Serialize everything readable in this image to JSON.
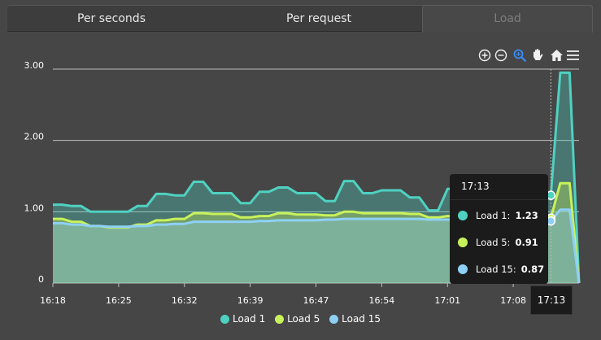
{
  "tabs": [
    {
      "label": "Per seconds",
      "active": false
    },
    {
      "label": "Per request",
      "active": false
    },
    {
      "label": "Load",
      "active": true
    }
  ],
  "toolbar": {
    "icons": [
      "zoom-in-icon",
      "zoom-out-icon",
      "selection-zoom-icon",
      "pan-hand-icon",
      "home-reset-icon",
      "menu-icon"
    ]
  },
  "colors": {
    "load1": "#4fd1c1",
    "load5": "#c8f25a",
    "load15": "#8ed0f5",
    "background": "#464646",
    "tooltip": "#1b1b1b"
  },
  "chart_data": {
    "type": "area",
    "ylim": [
      0,
      3
    ],
    "yticks": [
      "0",
      "1.00",
      "2.00",
      "3.00"
    ],
    "xticks": [
      "16:18",
      "16:25",
      "16:32",
      "16:39",
      "16:47",
      "16:54",
      "17:01",
      "17:08",
      "17:13"
    ],
    "legend_position": "bottom",
    "grid": true,
    "series": [
      {
        "name": "Load 1",
        "color": "#4fd1c1",
        "values": [
          1.1,
          1.1,
          1.08,
          1.08,
          1.0,
          1.0,
          1.0,
          1.0,
          1.0,
          1.08,
          1.08,
          1.25,
          1.25,
          1.23,
          1.23,
          1.42,
          1.42,
          1.26,
          1.26,
          1.26,
          1.12,
          1.12,
          1.28,
          1.28,
          1.34,
          1.34,
          1.26,
          1.26,
          1.26,
          1.15,
          1.15,
          1.43,
          1.43,
          1.26,
          1.26,
          1.3,
          1.3,
          1.3,
          1.2,
          1.2,
          1.02,
          1.02,
          1.32,
          1.32,
          1.38,
          1.38,
          1.25,
          1.25,
          1.2,
          1.2,
          1.4,
          1.4,
          1.22,
          1.23,
          2.95,
          2.95,
          0.0
        ]
      },
      {
        "name": "Load 5",
        "color": "#c8f25a",
        "values": [
          0.9,
          0.9,
          0.86,
          0.86,
          0.8,
          0.8,
          0.78,
          0.78,
          0.78,
          0.82,
          0.82,
          0.88,
          0.88,
          0.9,
          0.9,
          0.98,
          0.98,
          0.97,
          0.97,
          0.97,
          0.92,
          0.92,
          0.94,
          0.94,
          0.98,
          0.98,
          0.96,
          0.96,
          0.96,
          0.95,
          0.95,
          1.0,
          1.0,
          0.98,
          0.98,
          0.98,
          0.98,
          0.98,
          0.97,
          0.97,
          0.92,
          0.92,
          0.94,
          0.94,
          0.99,
          0.99,
          0.97,
          0.97,
          0.95,
          0.95,
          0.98,
          0.98,
          0.92,
          0.91,
          1.4,
          1.4,
          0.0
        ]
      },
      {
        "name": "Load 15",
        "color": "#8ed0f5",
        "values": [
          0.84,
          0.84,
          0.82,
          0.82,
          0.8,
          0.8,
          0.79,
          0.79,
          0.79,
          0.8,
          0.8,
          0.82,
          0.82,
          0.83,
          0.83,
          0.86,
          0.86,
          0.86,
          0.86,
          0.86,
          0.86,
          0.86,
          0.87,
          0.87,
          0.88,
          0.88,
          0.88,
          0.88,
          0.88,
          0.89,
          0.89,
          0.9,
          0.9,
          0.9,
          0.9,
          0.9,
          0.9,
          0.9,
          0.9,
          0.9,
          0.89,
          0.89,
          0.89,
          0.89,
          0.9,
          0.9,
          0.9,
          0.9,
          0.89,
          0.89,
          0.9,
          0.9,
          0.88,
          0.87,
          1.03,
          1.03,
          0.0
        ]
      }
    ]
  },
  "tooltip": {
    "title": "17:13",
    "rows": [
      {
        "name": "Load 1:",
        "value": "1.23",
        "color": "#4fd1c1"
      },
      {
        "name": "Load 5:",
        "value": "0.91",
        "color": "#c8f25a"
      },
      {
        "name": "Load 15:",
        "value": "0.87",
        "color": "#8ed0f5"
      }
    ]
  },
  "crosshair_label": "17:13"
}
